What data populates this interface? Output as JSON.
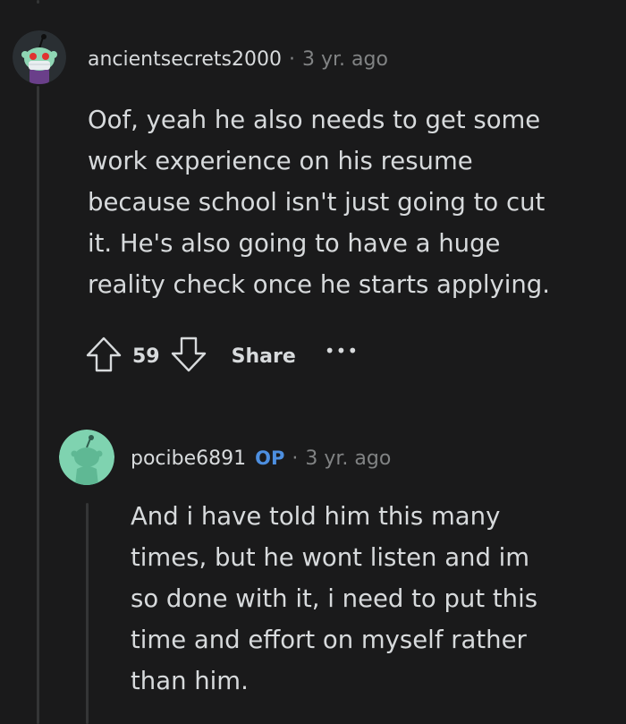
{
  "comments": [
    {
      "username": "ancientsecrets2000",
      "separator": "·",
      "time": "3 yr. ago",
      "body_lines": [
        "Oof, yeah he also needs to get some",
        "work experience on his resume",
        "because school isn't just going to cut",
        "it. He's also going to have a huge",
        "reality check once he starts applying."
      ],
      "votes": "59",
      "share_label": "Share",
      "more_label": "•••"
    },
    {
      "username": "pocibe6891",
      "op_badge": "OP",
      "separator": "·",
      "time": "3 yr. ago",
      "body_lines": [
        "And i have told him this many",
        "times, but he wont listen and im",
        "so done with it, i need to put this",
        "time and effort on myself rather",
        "than him."
      ]
    }
  ],
  "colors": {
    "background": "#1a1a1b",
    "text": "#d7dadc",
    "muted": "#818384",
    "op_badge": "#4d8fe0"
  }
}
